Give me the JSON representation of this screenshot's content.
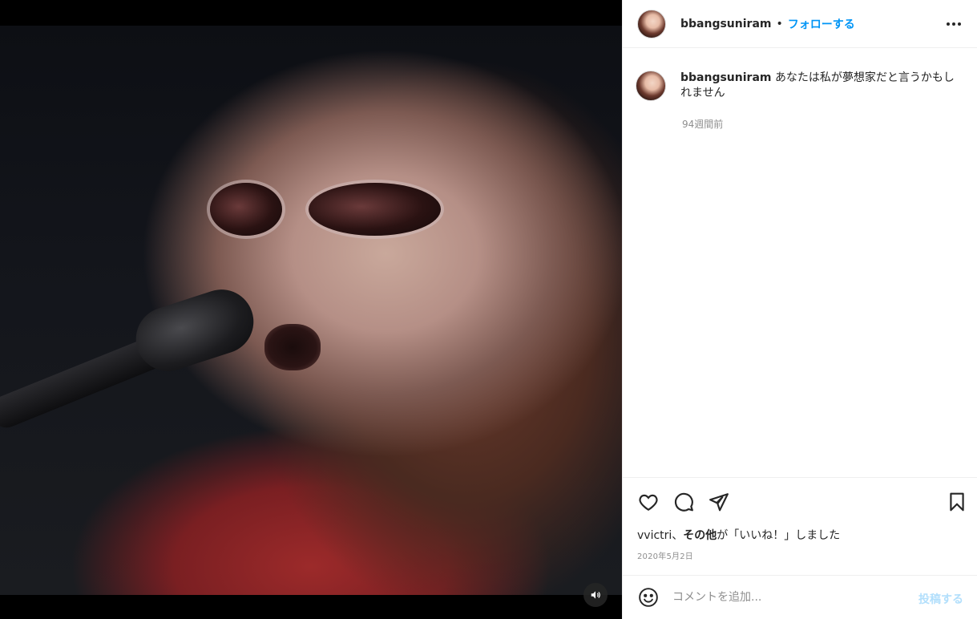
{
  "post": {
    "username": "bbangsuniram",
    "separator": "•",
    "follow_label": "フォローする",
    "caption": "あなたは私が夢想家だと言うかもしれません",
    "caption_time": "94週間前",
    "likes_user": "vvictri",
    "likes_sep": "、",
    "likes_others": "その他",
    "likes_suffix": "が「いいね！」しました",
    "date": "2020年5月2日"
  },
  "comment": {
    "placeholder": "コメントを追加...",
    "post_label": "投稿する"
  },
  "icons": {
    "more": "more-options-icon",
    "like": "heart-icon",
    "comment": "comment-icon",
    "share": "paper-plane-icon",
    "save": "bookmark-icon",
    "emoji": "emoji-icon",
    "audio": "speaker-icon"
  },
  "colors": {
    "accent": "#0095f6",
    "post_disabled": "#b2dffc",
    "secondary_text": "#8e8e8e"
  }
}
